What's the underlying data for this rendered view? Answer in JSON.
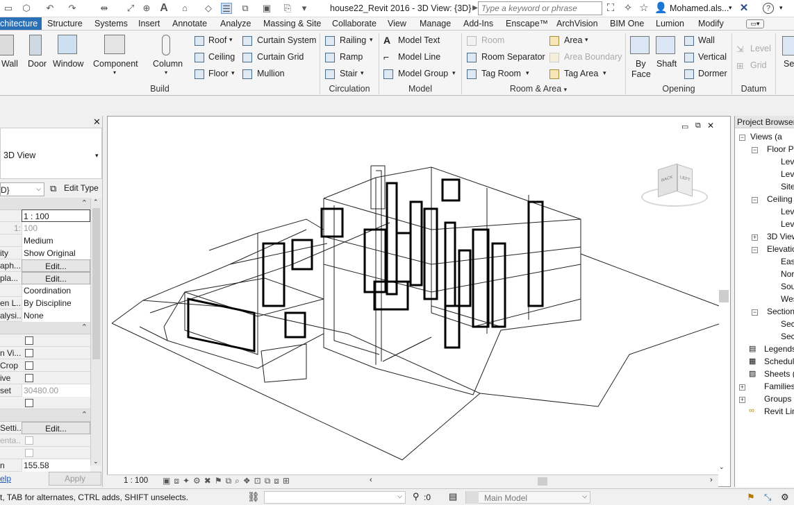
{
  "title": "house22_Revit 2016 - 3D View: {3D}",
  "search_placeholder": "Type a keyword or phrase",
  "user": "Mohamed.als...",
  "tabs": [
    "chitecture",
    "Structure",
    "Systems",
    "Insert",
    "Annotate",
    "Analyze",
    "Massing & Site",
    "Collaborate",
    "View",
    "Manage",
    "Add-Ins",
    "Enscape™",
    "ArchVision",
    "BIM One",
    "Lumion",
    "Modify"
  ],
  "ribbon": {
    "build": {
      "wall": "Wall",
      "door": "Door",
      "window": "Window",
      "component": "Component",
      "column": "Column",
      "roof": "Roof",
      "ceiling": "Ceiling",
      "floor": "Floor",
      "curtain_system": "Curtain System",
      "curtain_grid": "Curtain Grid",
      "mullion": "Mullion",
      "panel": "Build"
    },
    "circulation": {
      "railing": "Railing",
      "ramp": "Ramp",
      "stair": "Stair",
      "panel": "Circulation"
    },
    "model": {
      "text": "Model Text",
      "line": "Model Line",
      "group": "Model Group",
      "panel": "Model"
    },
    "room": {
      "room": "Room",
      "separator": "Room Separator",
      "tag_room": "Tag Room",
      "area": "Area",
      "area_boundary": "Area Boundary",
      "tag_area": "Tag Area",
      "panel": "Room & Area"
    },
    "opening": {
      "by_face_1": "By",
      "by_face_2": "Face",
      "shaft": "Shaft",
      "wall": "Wall",
      "vertical": "Vertical",
      "dormer": "Dormer",
      "panel": "Opening"
    },
    "datum": {
      "level": "Level",
      "grid": "Grid",
      "panel": "Datum",
      "se": "Se"
    }
  },
  "properties": {
    "type": "3D View",
    "selector": "D}",
    "edit_type": "Edit Type",
    "rows": [
      {
        "k": "",
        "v": "1 : 100"
      },
      {
        "k": "1:",
        "v": "100"
      },
      {
        "k": "",
        "v": "Medium"
      },
      {
        "k": "ity",
        "v": "Show Original"
      },
      {
        "k": "aph...",
        "v": "Edit..."
      },
      {
        "k": "pla...",
        "v": "Edit..."
      },
      {
        "k": "",
        "v": "Coordination"
      },
      {
        "k": "en L...",
        "v": "By Discipline"
      },
      {
        "k": "alysi...",
        "v": "None"
      }
    ],
    "rows2": [
      {
        "k": ""
      },
      {
        "k": "n Vi..."
      },
      {
        "k": "Crop"
      },
      {
        "k": "ive"
      },
      {
        "k": "set",
        "v": "30480.00"
      },
      {
        "k": ""
      }
    ],
    "sett": "Setti...",
    "sett_v": "Edit...",
    "enta": "enta...",
    "n": "n",
    "n_v": "155.58",
    "help": "elp",
    "apply": "Apply"
  },
  "browser": {
    "title": "Project Browser",
    "items": [
      "Views (a",
      "Floor Pl",
      "Leve",
      "Leve",
      "Site",
      "Ceiling",
      "Leve",
      "Leve",
      "3D View",
      "Elevatio",
      "East",
      "Nor",
      "Sou",
      "Wes",
      "Section",
      "Sect",
      "Sect",
      "Legends",
      "Schedul",
      "Sheets (a",
      "Families",
      "Groups",
      "Revit Lin"
    ]
  },
  "viewbar": {
    "scale": "1 : 100"
  },
  "status": {
    "hint": "t, TAB for alternates, CTRL adds, SHIFT unselects.",
    "count": ":0",
    "model": "Main Model"
  },
  "viewcube": {
    "back": "BACK",
    "left": "LEFT"
  }
}
